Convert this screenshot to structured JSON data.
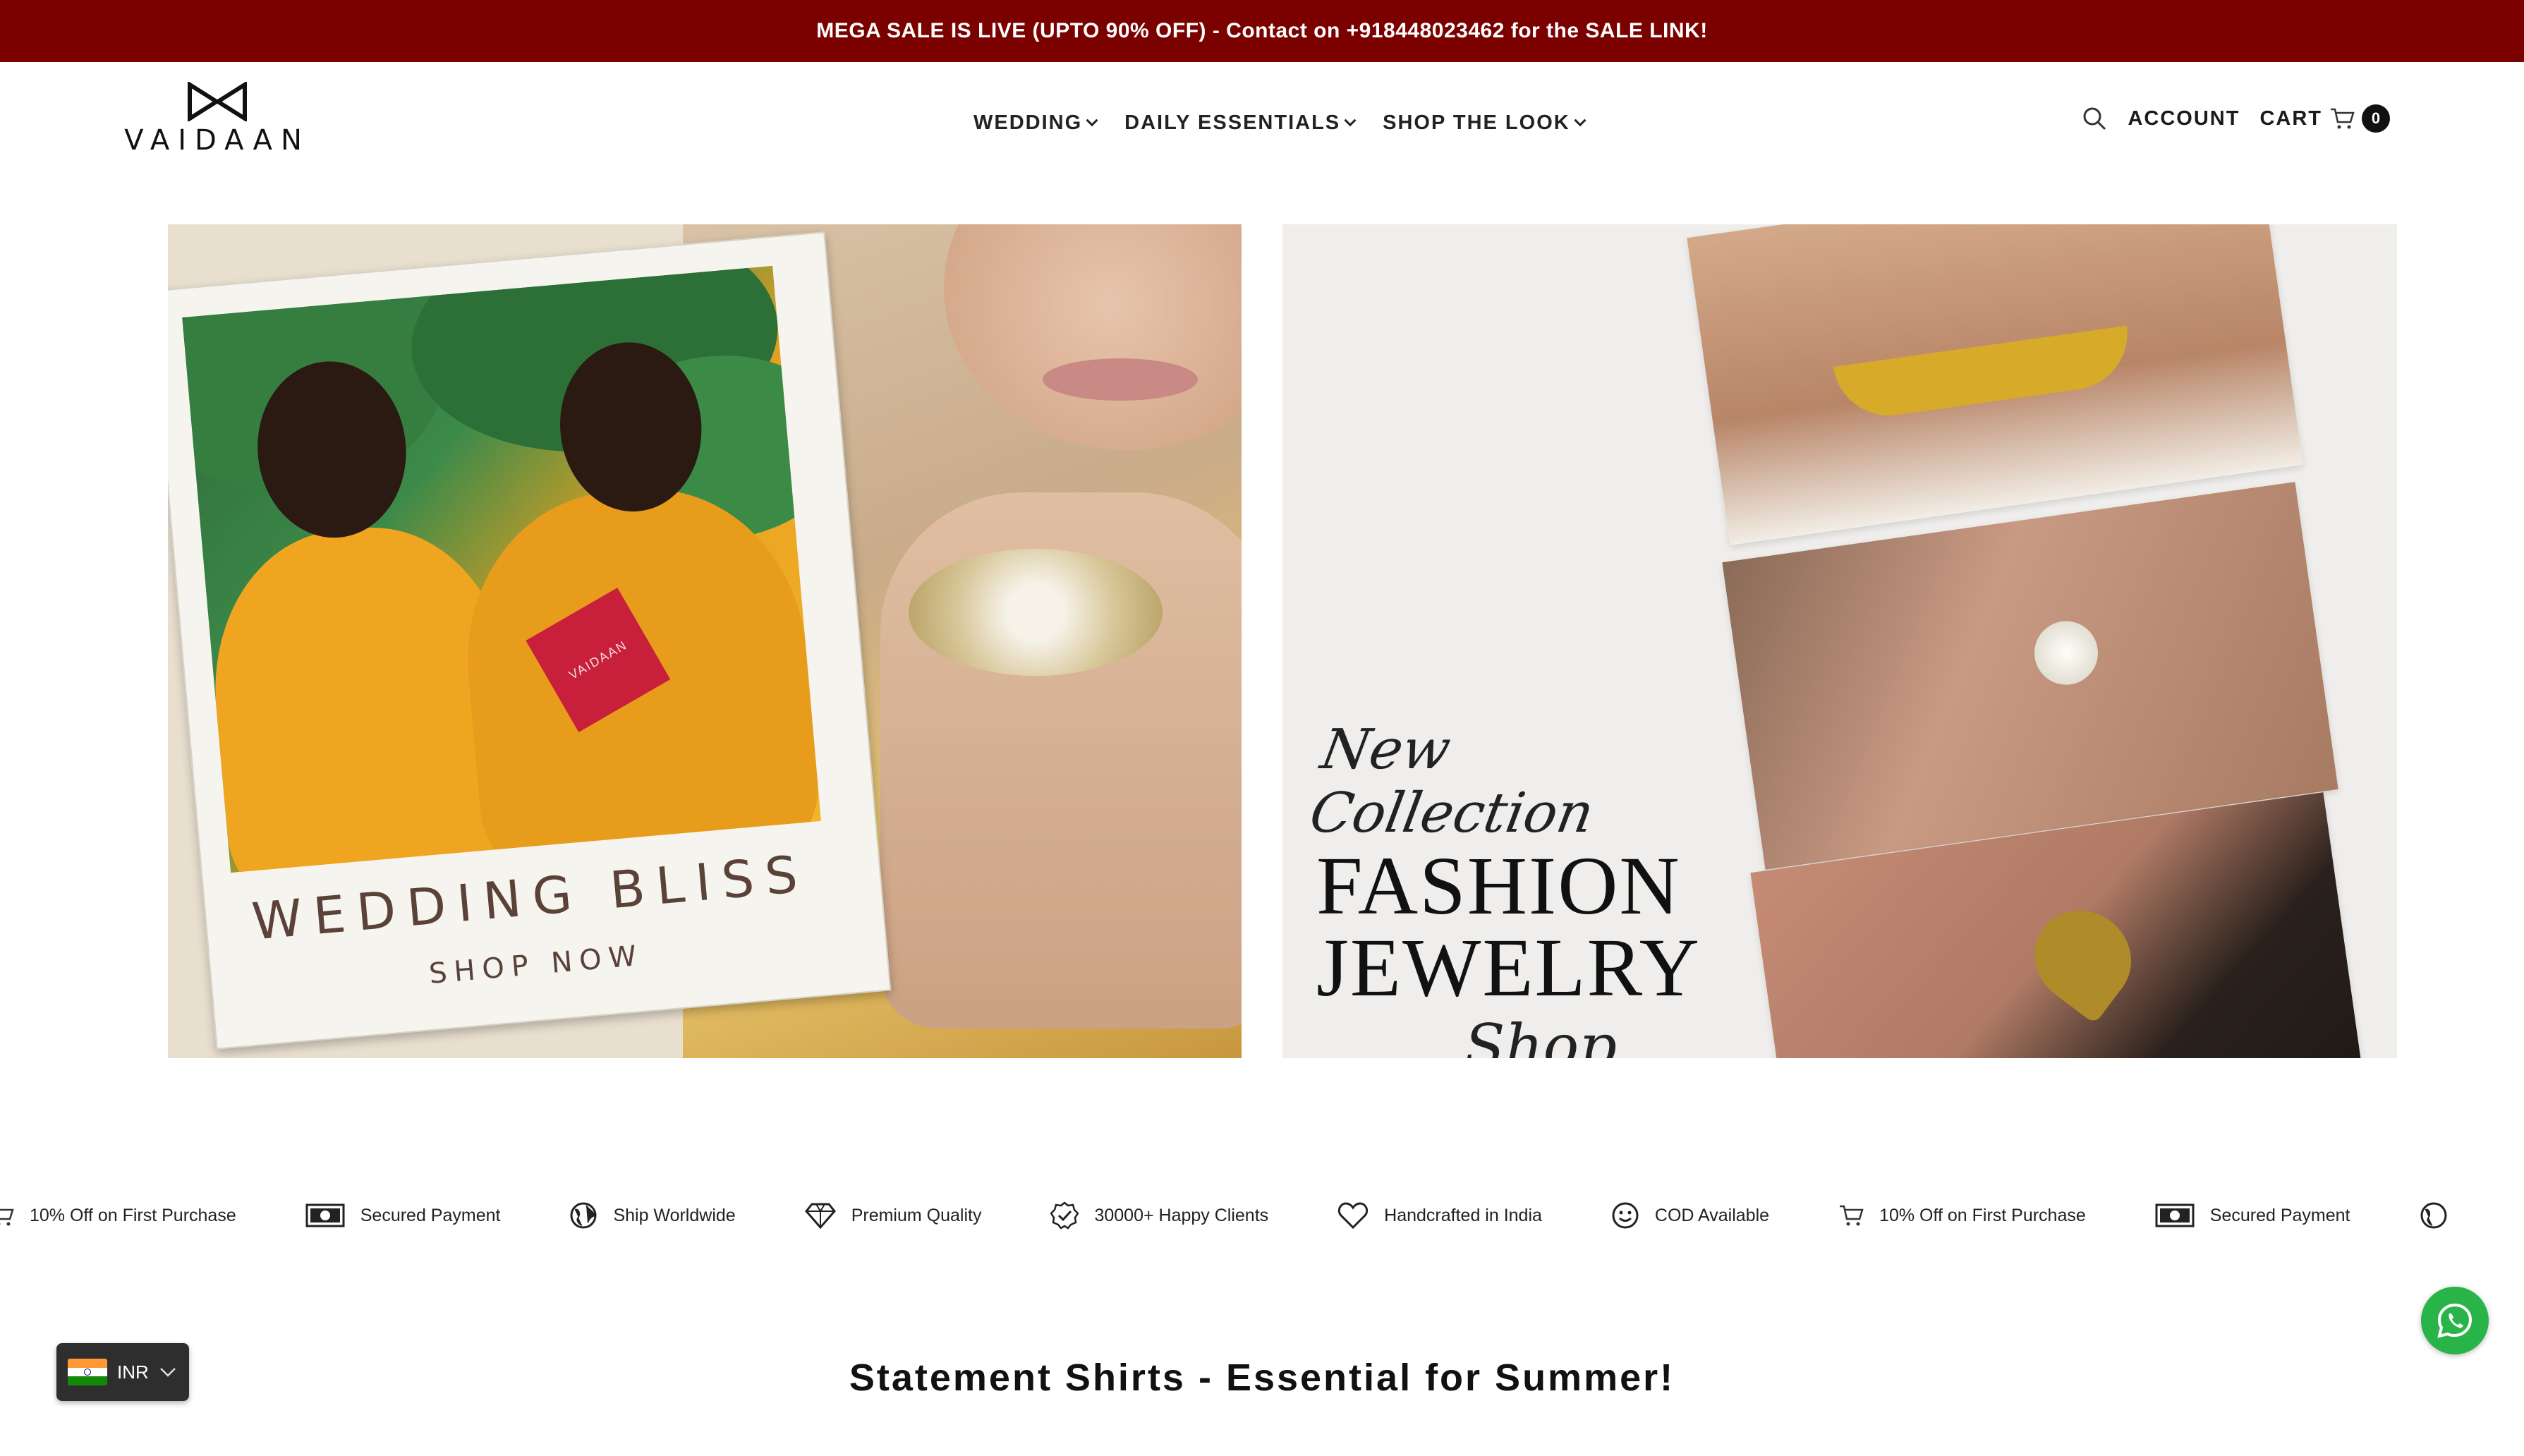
{
  "announcement": {
    "text": "MEGA SALE IS LIVE (UPTO 90% OFF) - Contact on +918448023462 for the SALE LINK!",
    "bg_color": "#7b0000"
  },
  "header": {
    "logo_text": "VAIDAAN",
    "nav": [
      {
        "label": "WEDDING",
        "icon": "chevron-down-icon"
      },
      {
        "label": "DAILY ESSENTIALS",
        "icon": "chevron-down-icon"
      },
      {
        "label": "SHOP THE LOOK",
        "icon": "chevron-down-icon"
      }
    ],
    "search_icon": "search-icon",
    "account_label": "ACCOUNT",
    "cart_label": "CART",
    "cart_icon": "cart-icon",
    "cart_count": "0"
  },
  "banners": {
    "left": {
      "title": "WEDDING BLISS",
      "subtitle": "SHOP NOW",
      "box_text": "VAIDAAN"
    },
    "right": {
      "script_top": "New Collection",
      "line1": "FASHION",
      "line2": "JEWELRY",
      "script_bottom": "Shop Now"
    }
  },
  "features": [
    {
      "icon": "cart-icon",
      "label": "10% Off on First Purchase"
    },
    {
      "icon": "cash-icon",
      "label": "Secured Payment"
    },
    {
      "icon": "globe-icon",
      "label": "Ship Worldwide"
    },
    {
      "icon": "diamond-icon",
      "label": "Premium Quality"
    },
    {
      "icon": "verified-badge-icon",
      "label": "30000+ Happy Clients"
    },
    {
      "icon": "heart-icon",
      "label": "Handcrafted in India"
    },
    {
      "icon": "smile-icon",
      "label": "COD Available"
    },
    {
      "icon": "cart-icon",
      "label": "10% Off on First Purchase"
    },
    {
      "icon": "cash-icon",
      "label": "Secured Payment"
    }
  ],
  "section": {
    "title": "Statement Shirts - Essential for Summer!"
  },
  "currency": {
    "code": "INR",
    "flag_icon": "india-flag-icon"
  },
  "whatsapp": {
    "icon": "whatsapp-icon"
  }
}
